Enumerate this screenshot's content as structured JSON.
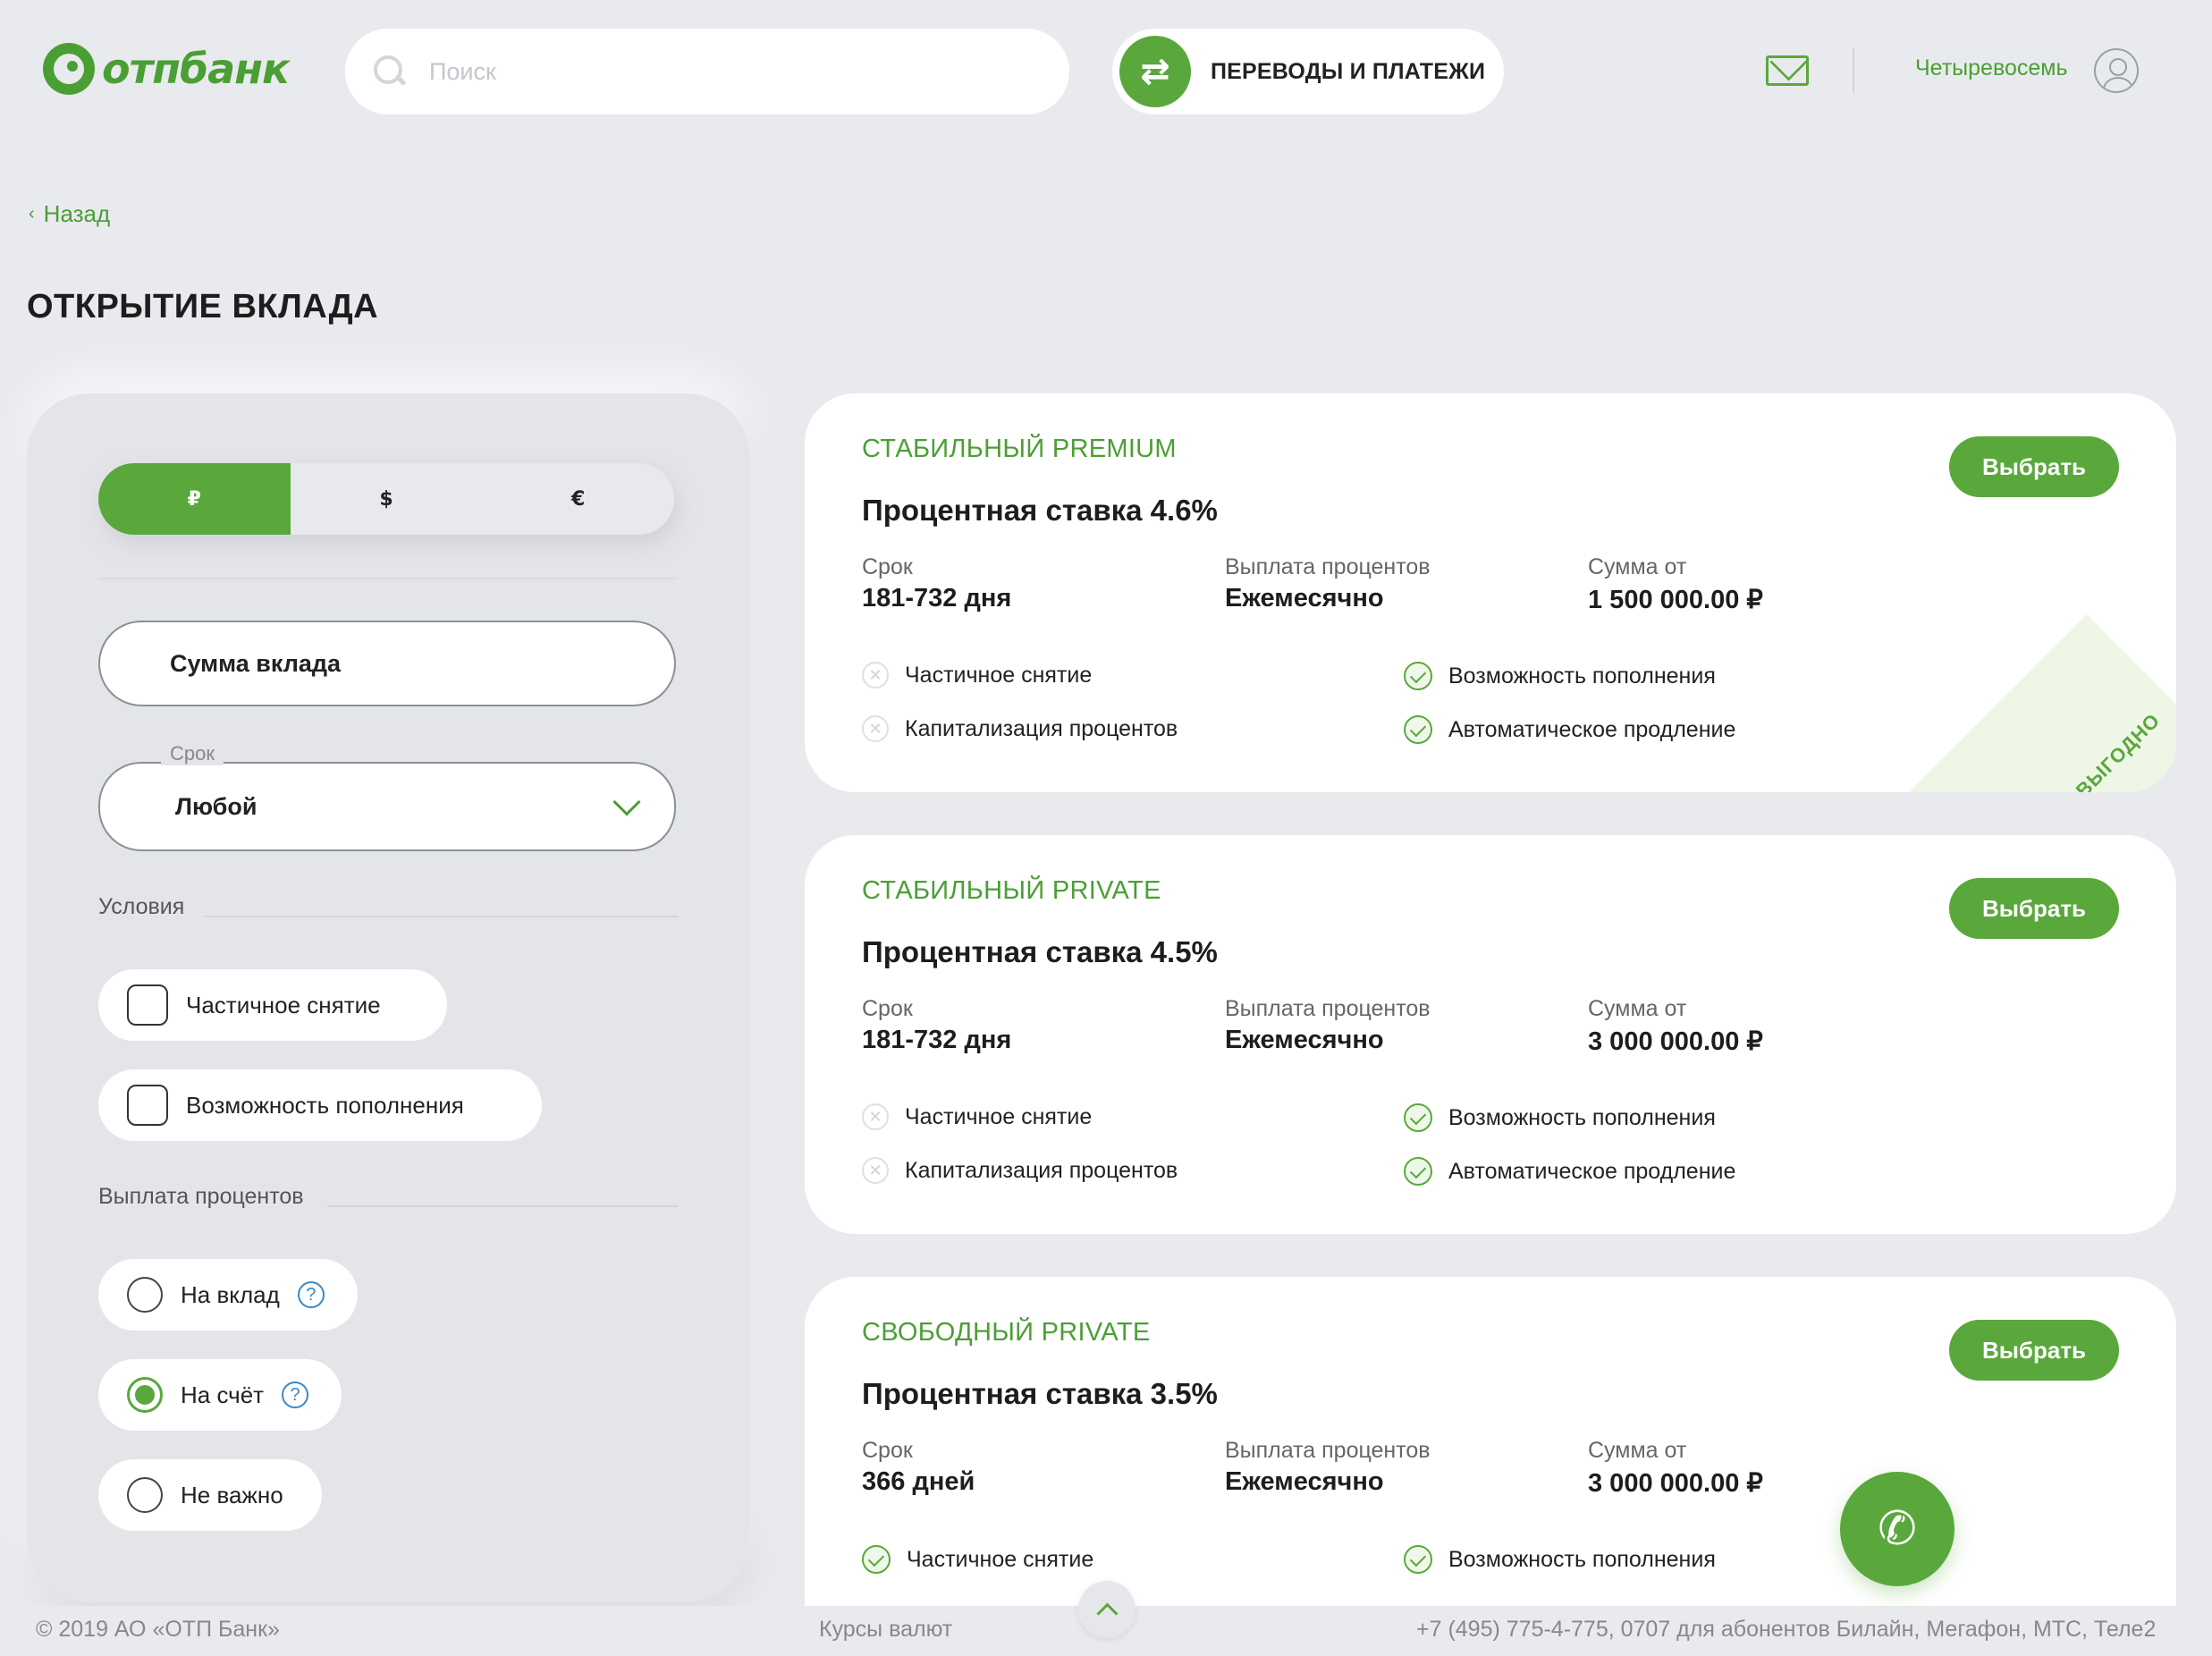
{
  "header": {
    "logo_text": "отпбанк",
    "search_placeholder": "Поиск",
    "transfers_label": "ПЕРЕВОДЫ И ПЛАТЕЖИ",
    "username": "Четыревосемь"
  },
  "nav": {
    "back_label": "Назад"
  },
  "page": {
    "title": "ОТКРЫТИЕ ВКЛАДА"
  },
  "filters": {
    "currencies": [
      "₽",
      "$",
      "€"
    ],
    "selected_currency": "₽",
    "sum_placeholder": "Сумма вклада",
    "term_label": "Срок",
    "term_value": "Любой",
    "conditions_label": "Условия",
    "conditions": [
      "Частичное снятие",
      "Возможность пополнения"
    ],
    "payout_label": "Выплата процентов",
    "payout_options": [
      "На вклад",
      "На счёт",
      "Не важно"
    ],
    "payout_selected": "На счёт"
  },
  "labels": {
    "term": "Срок",
    "payout": "Выплата процентов",
    "amount_from": "Сумма от",
    "choose": "Выбрать",
    "badge": "ВЫГОДНО"
  },
  "deposits": [
    {
      "name": "СТАБИЛЬНЫЙ PREMIUM",
      "rate": "Процентная ставка 4.6%",
      "term": "181-732 дня",
      "payout": "Ежемесячно",
      "amount": "1 500 000.00 ₽",
      "features": [
        {
          "label": "Частичное снятие",
          "available": false
        },
        {
          "label": "Возможность пополнения",
          "available": true
        },
        {
          "label": "Капитализация процентов",
          "available": false
        },
        {
          "label": "Автоматическое продление",
          "available": true
        }
      ],
      "badge": true
    },
    {
      "name": "СТАБИЛЬНЫЙ PRIVATE",
      "rate": "Процентная ставка 4.5%",
      "term": "181-732 дня",
      "payout": "Ежемесячно",
      "amount": "3 000 000.00 ₽",
      "features": [
        {
          "label": "Частичное снятие",
          "available": false
        },
        {
          "label": "Возможность пополнения",
          "available": true
        },
        {
          "label": "Капитализация процентов",
          "available": false
        },
        {
          "label": "Автоматическое продление",
          "available": true
        }
      ],
      "badge": false
    },
    {
      "name": "СВОБОДНЫЙ PRIVATE",
      "rate": "Процентная ставка 3.5%",
      "term": "366 дней",
      "payout": "Ежемесячно",
      "amount": "3 000 000.00 ₽",
      "features": [
        {
          "label": "Частичное снятие",
          "available": true
        },
        {
          "label": "Возможность пополнения",
          "available": true
        }
      ],
      "badge": false
    }
  ],
  "footer": {
    "copyright": "© 2019 АО «ОТП Банк»",
    "rates_link": "Курсы валют",
    "phones": "+7 (495) 775-4-775,  0707 для абонентов Билайн, Мегафон, МТС, Теле2"
  },
  "colors": {
    "accent": "#5aa83c",
    "brand_green": "#4a9f34",
    "background": "#e9eaee",
    "help": "#3a88c8"
  },
  "icons": [
    "search-icon",
    "transfer-icon",
    "mail-icon",
    "avatar-icon",
    "chevron-left-icon",
    "chevron-down-icon",
    "checkbox-icon",
    "radio-icon",
    "help-icon",
    "check-icon",
    "cross-icon",
    "chat-phone-icon",
    "arrow-up-icon"
  ]
}
